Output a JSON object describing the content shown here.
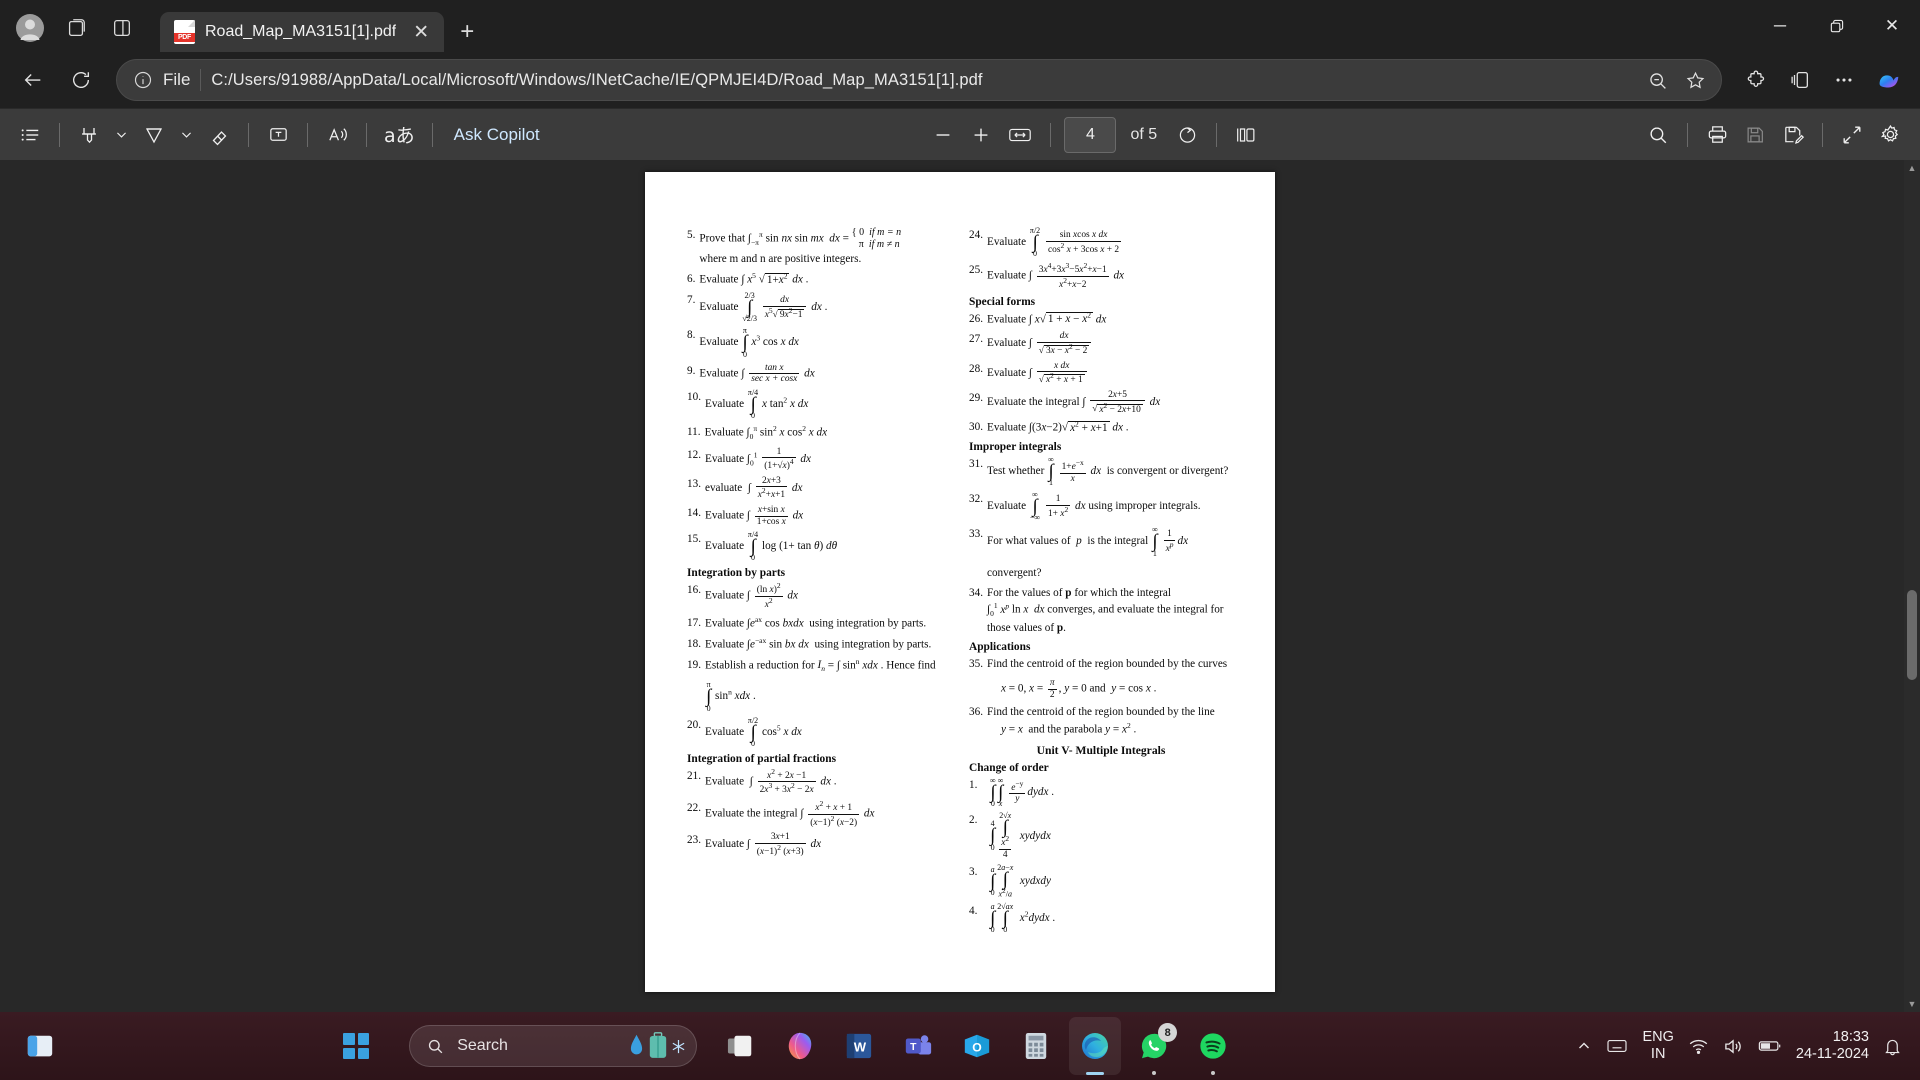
{
  "window": {
    "tab_title": "Road_Map_MA3151[1].pdf",
    "new_tab_label": "+",
    "close_tab_label": "✕",
    "minimize_label": "─",
    "restore_label": "❐",
    "close_label": "✕"
  },
  "address": {
    "file_label": "File",
    "url": "C:/Users/91988/AppData/Local/Microsoft/Windows/INetCache/IE/QPMJEI4D/Road_Map_MA3151[1].pdf"
  },
  "pdf_toolbar": {
    "ask_copilot": "Ask Copilot",
    "zoom_out": "−",
    "zoom_in": "+",
    "page_current": "4",
    "page_total_label": "of 5",
    "icons": [
      "table-of-contents-icon",
      "highlight-icon",
      "highlight-chevron-icon",
      "pen-icon",
      "pen-chevron-icon",
      "eraser-icon",
      "text-box-icon",
      "read-aloud-icon",
      "translate-icon",
      "fit-to-width-icon",
      "reset-zoom-icon",
      "two-page-view-icon",
      "search-icon",
      "print-icon",
      "save-icon",
      "save-as-icon",
      "fullscreen-icon",
      "settings-icon"
    ]
  },
  "document": {
    "left_column": [
      {
        "num": "5.",
        "text": "Prove that ∫₋πⁿ sin nx sin mx  dx = { 0 if m = n ; π if m ≠ n where m and n are positive integers."
      },
      {
        "num": "6.",
        "text": "Evaluate ∫ x⁵ √(1+x²) dx ."
      },
      {
        "num": "7.",
        "text": "Evaluate ∫ from √2/3 to 2/3  dx / (x⁵√(9x²−1)) dx ."
      },
      {
        "num": "8.",
        "text": "Evaluate ∫₀^π x³ cos x dx"
      },
      {
        "num": "9.",
        "text": "Evaluate ∫ tan x / (sec x + cosx) dx"
      },
      {
        "num": "10.",
        "text": "Evaluate ∫₀^(π/4) x tan² x dx"
      },
      {
        "num": "11.",
        "text": "Evaluate ∫₀^π sin² x cos² x  dx"
      },
      {
        "num": "12.",
        "text": "Evaluate ∫₀¹ 1/(1+√x)⁴ dx"
      },
      {
        "num": "13.",
        "text": "evaluate ∫ (2x+3)/(x²+x+1) dx"
      },
      {
        "num": "14.",
        "text": "Evaluate ∫ (x+sin x)/(1+cos x) dx"
      },
      {
        "num": "15.",
        "text": "Evaluate ∫₀^(π/4) log (1+ tan θ) dθ"
      },
      {
        "num": "16.",
        "text": "Evaluate ∫ (ln x)² / x² dx"
      },
      {
        "num": "17.",
        "text": "Evaluate ∫ e^{ax} cos bxdx  using integration by parts."
      },
      {
        "num": "18.",
        "text": "Evaluate ∫ e^{-ax} sin bx dx  using integration by parts."
      },
      {
        "num": "19.",
        "text": "Establish a reduction for Iₙ = ∫ sinⁿ xdx . Hence find ∫₀^π sinⁿ xdx ."
      },
      {
        "num": "20.",
        "text": "Evaluate ∫₀^(π/2) cos⁵ x dx"
      },
      {
        "num": "21.",
        "text": "Evaluate ∫ (x²+2x−1)/(2x³+3x²−2x) dx ."
      },
      {
        "num": "22.",
        "text": "Evaluate the integral ∫ (x²+x+1)/((x−1)²(x−2)) dx"
      },
      {
        "num": "23.",
        "text": "Evaluate ∫ (3x+1)/((x−1)²(x+3)) dx"
      }
    ],
    "left_headings": {
      "integration_by_parts": "Integration by parts",
      "partial_fractions": "Integration of partial fractions"
    },
    "right_column": [
      {
        "num": "24.",
        "text": "Evaluate ∫₀^(π/2) sin x cos x dx / (cos² x + 3cos x + 2)"
      },
      {
        "num": "25.",
        "text": "Evaluate ∫ (3x⁴+3x³−5x²+x−1)/(x²+x−2) dx"
      },
      {
        "num": "26.",
        "text": "Evaluate ∫ x√(1 + x − x²) dx"
      },
      {
        "num": "27.",
        "text": "Evaluate ∫ dx / √(3x − x² − 2)"
      },
      {
        "num": "28.",
        "text": "Evaluate ∫ x dx / √(x² + x + 1)"
      },
      {
        "num": "29.",
        "text": "Evaluate the integral ∫ (2x+5)/√(x²−2x+10) dx"
      },
      {
        "num": "30.",
        "text": "Evaluate ∫ (3x−2)√(x²+x+1) dx ."
      },
      {
        "num": "31.",
        "text": "Test whether ∫₁^∞ (1+e⁻ˣ)/x dx  is convergent or divergent?"
      },
      {
        "num": "32.",
        "text": "Evaluate ∫₋∞^∞ 1/(1+x²) dx using improper integrals."
      },
      {
        "num": "33.",
        "text": "For what values of  p  is the integral ∫₁^∞ (1/xᵖ)dx convergent?"
      },
      {
        "num": "34.",
        "text": "For the values of p for which the integral ∫₀¹ xᵖ ln x  dx converges, and evaluate the integral for those values of p."
      },
      {
        "num": "35.",
        "text": "Find the centroid of the region bounded by the curves x = 0, x = π/2, y = 0 and  y = cos x ."
      },
      {
        "num": "36.",
        "text": "Find the centroid of the region bounded by the line y = x  and the parabola y = x² ."
      }
    ],
    "right_headings": {
      "special_forms": "Special forms",
      "improper_integrals": "Improper integrals",
      "applications": "Applications",
      "unit_title": "Unit V- Multiple Integrals",
      "change_of_order": "Change of order"
    },
    "change_of_order": [
      {
        "num": "1.",
        "text": "∫₀^∞ ∫ₓ^∞ (e⁻ʸ/y) dydx ."
      },
      {
        "num": "2.",
        "text": "∫₀⁴ ∫_{x²/4}^{2√x} xydydx"
      },
      {
        "num": "3.",
        "text": "∫₀^a ∫_{x²/a}^{2a−x} xydxdy"
      },
      {
        "num": "4.",
        "text": "∫₀^a ∫₀^{2√ax} x²dydx ."
      }
    ]
  },
  "taskbar": {
    "search_placeholder": "Search",
    "apps": [
      "start-icon",
      "task-view-icon",
      "copilot-icon",
      "word-icon",
      "teams-icon",
      "outlook-icon",
      "calculator-icon",
      "edge-icon",
      "whatsapp-icon",
      "spotify-icon"
    ],
    "whatsapp_badge": "8",
    "language": "ENG",
    "region": "IN",
    "time": "18:33",
    "date": "24-11-2024"
  },
  "colors": {
    "chrome_bg": "#202020",
    "toolbar_bg": "#3b3b3b",
    "doc_bg": "#282828",
    "accent": "#9fd4f2",
    "taskbar_bg": "#3a1b22"
  }
}
